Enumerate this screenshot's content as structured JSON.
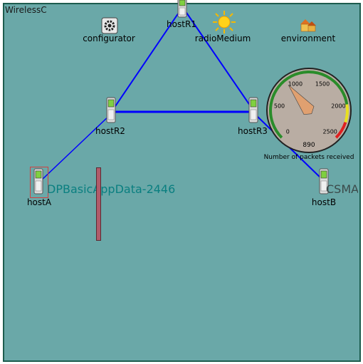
{
  "network": {
    "title": "WirelessC"
  },
  "nodes": {
    "hostR1": "hostR1",
    "hostR2": "hostR2",
    "hostR3": "hostR3",
    "hostA": "hostA",
    "hostB": "hostB",
    "configurator": "configurator",
    "radioMedium": "radioMedium",
    "environment": "environment"
  },
  "overlays": {
    "app_data": "DPBasicAppData-2446",
    "mac_text": "CSMA-A"
  },
  "gauge": {
    "caption": "Number of packets received",
    "value": 890,
    "value_label": "890",
    "ticks": [
      "0",
      "500",
      "1000",
      "1500",
      "2000",
      "2500"
    ],
    "min": 0,
    "max": 2500,
    "colors": {
      "normal": "#2a8c2a",
      "warning": "#e8e020",
      "critical": "#e02020",
      "needle": "#e0a070",
      "face": "#b9ada3"
    }
  },
  "colors": {
    "canvas": "#6aa8a8",
    "link": "#0000ff"
  }
}
